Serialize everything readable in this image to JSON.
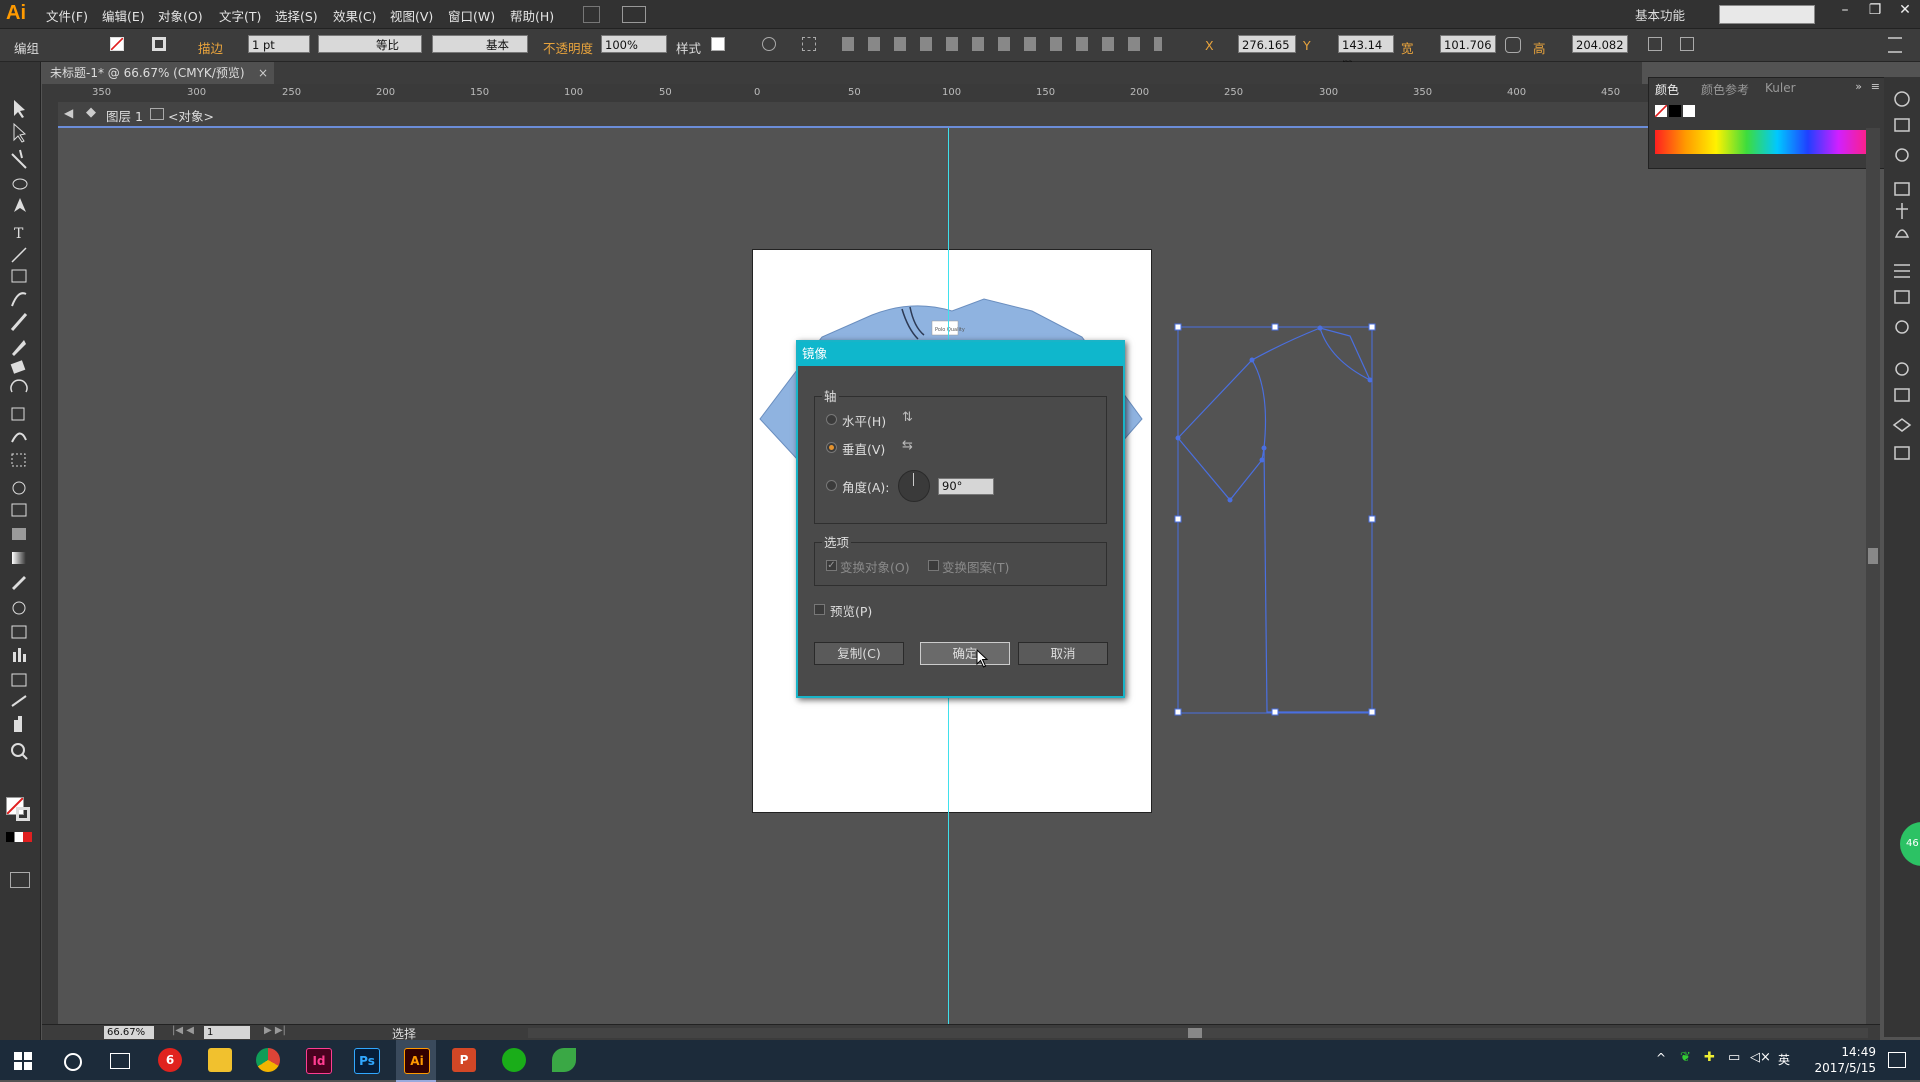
{
  "app": {
    "logo": "Ai",
    "workspace": "基本功能"
  },
  "menu": [
    "文件(F)",
    "编辑(E)",
    "对象(O)",
    "文字(T)",
    "选择(S)",
    "效果(C)",
    "视图(V)",
    "窗口(W)",
    "帮助(H)"
  ],
  "control": {
    "selection_type": "编组",
    "stroke_label": "描边",
    "stroke_weight": "1 pt",
    "stroke_profile": "等比",
    "brush_label": "基本",
    "opacity_label": "不透明度",
    "opacity_value": "100%",
    "style_label": "样式",
    "x_value": "276.165",
    "y_value": "143.14 m",
    "w_value": "101.706",
    "h_value": "204.082"
  },
  "document": {
    "tab_title": "未标题-1* @ 66.67% (CMYK/预览)",
    "layer": "图层 1",
    "object_crumb": "<对象>"
  },
  "ruler": [
    "350",
    "300",
    "250",
    "200",
    "150",
    "100",
    "50",
    "0",
    "50",
    "100",
    "150",
    "200",
    "250",
    "300",
    "350",
    "400",
    "450"
  ],
  "color_panel": {
    "tabs": [
      "颜色",
      "颜色参考",
      "Kuler"
    ]
  },
  "dialog": {
    "title": "镜像",
    "axis_group": "轴",
    "horizontal": "水平(H)",
    "vertical": "垂直(V)",
    "angle": "角度(A):",
    "angle_value": "90°",
    "options_group": "选项",
    "transform_objects": "变换对象(O)",
    "transform_patterns": "变换图案(T)",
    "preview": "预览(P)",
    "copy_button": "复制(C)",
    "ok_button": "确定",
    "cancel_button": "取消",
    "selected_axis": "vertical"
  },
  "status": {
    "zoom": "66.67%",
    "page": "1",
    "tool": "选择"
  },
  "tshirt_tag": "Polo Quality",
  "taskbar": {
    "time": "14:49",
    "date": "2017/5/15",
    "ime": "英"
  },
  "colors": {
    "accent": "#0fb7cc",
    "guide": "#3fe0ec",
    "selection": "#4a6fe0",
    "shirt": "#8fb3e0"
  }
}
